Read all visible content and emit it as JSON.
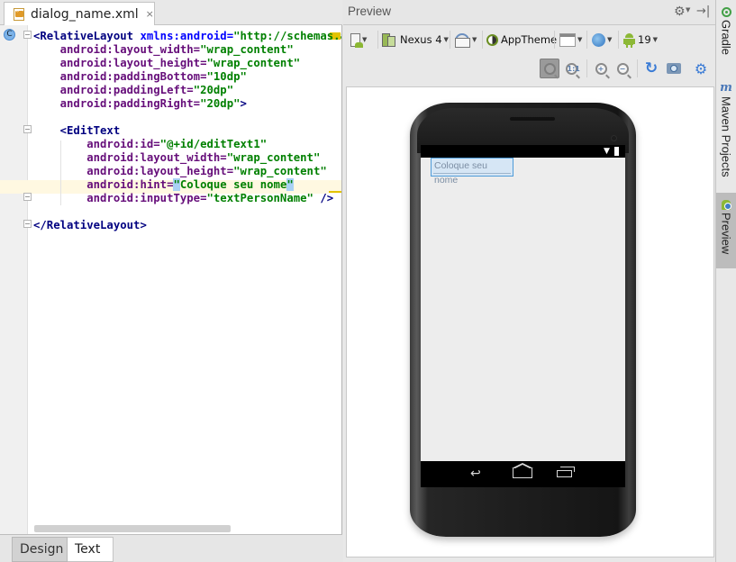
{
  "editor": {
    "file_tab": {
      "name": "dialog_name.xml",
      "close": "×"
    },
    "gutter_badge": "C",
    "code_lines": [
      [
        {
          "c": "tag",
          "t": "<RelativeLayout "
        },
        {
          "c": "ns",
          "t": "xmlns:android="
        },
        {
          "c": "val",
          "t": "\"http://schemas.a"
        }
      ],
      [
        {
          "c": "attr",
          "t": "    android:layout_width="
        },
        {
          "c": "val",
          "t": "\"wrap_content\""
        }
      ],
      [
        {
          "c": "attr",
          "t": "    android:layout_height="
        },
        {
          "c": "val",
          "t": "\"wrap_content\""
        }
      ],
      [
        {
          "c": "attr",
          "t": "    android:paddingBottom="
        },
        {
          "c": "val",
          "t": "\"10dp\""
        }
      ],
      [
        {
          "c": "attr",
          "t": "    android:paddingLeft="
        },
        {
          "c": "val",
          "t": "\"20dp\""
        }
      ],
      [
        {
          "c": "attr",
          "t": "    android:paddingRight="
        },
        {
          "c": "val",
          "t": "\"20dp\""
        },
        {
          "c": "tag",
          "t": ">"
        }
      ],
      [],
      [
        {
          "c": "tag",
          "t": "    <EditText"
        }
      ],
      [
        {
          "c": "attr",
          "t": "        android:id="
        },
        {
          "c": "val",
          "t": "\"@+id/editText1\""
        }
      ],
      [
        {
          "c": "attr",
          "t": "        android:layout_width="
        },
        {
          "c": "val",
          "t": "\"wrap_content\""
        }
      ],
      [
        {
          "c": "attr",
          "t": "        android:layout_height="
        },
        {
          "c": "val",
          "t": "\"wrap_content\""
        }
      ],
      [
        {
          "c": "attr",
          "t": "        android:hint="
        },
        {
          "c": "sel",
          "t": "\""
        },
        {
          "c": "val",
          "t": "Coloque seu nome"
        },
        {
          "c": "sel",
          "t": "\""
        }
      ],
      [
        {
          "c": "attr",
          "t": "        android:inputType="
        },
        {
          "c": "val",
          "t": "\"textPersonName\""
        },
        {
          "c": "tag",
          "t": " />"
        }
      ],
      [],
      [
        {
          "c": "tag",
          "t": "</RelativeLayout>"
        }
      ]
    ],
    "bottom_tabs": {
      "design": "Design",
      "text": "Text",
      "active": "Text"
    }
  },
  "preview": {
    "title": "Preview",
    "header_icons": [
      "gear-icon",
      "hide-panel-icon"
    ],
    "toolbar": {
      "device": "Nexus 4",
      "theme": "AppTheme",
      "api_level": "19"
    },
    "zoom_tools": [
      "zoom-to-fit",
      "actual-size",
      "zoom-in",
      "zoom-out",
      "refresh",
      "screenshot",
      "options"
    ],
    "device_screen": {
      "edittext_hint": "Coloque seu nome"
    }
  },
  "tool_strip": {
    "items": [
      {
        "label": "Gradle",
        "icon": "gradle-icon",
        "active": false
      },
      {
        "label": "Maven Projects",
        "icon": "maven-icon",
        "active": false
      },
      {
        "label": "Preview",
        "icon": "android-preview-icon",
        "active": true
      }
    ]
  }
}
